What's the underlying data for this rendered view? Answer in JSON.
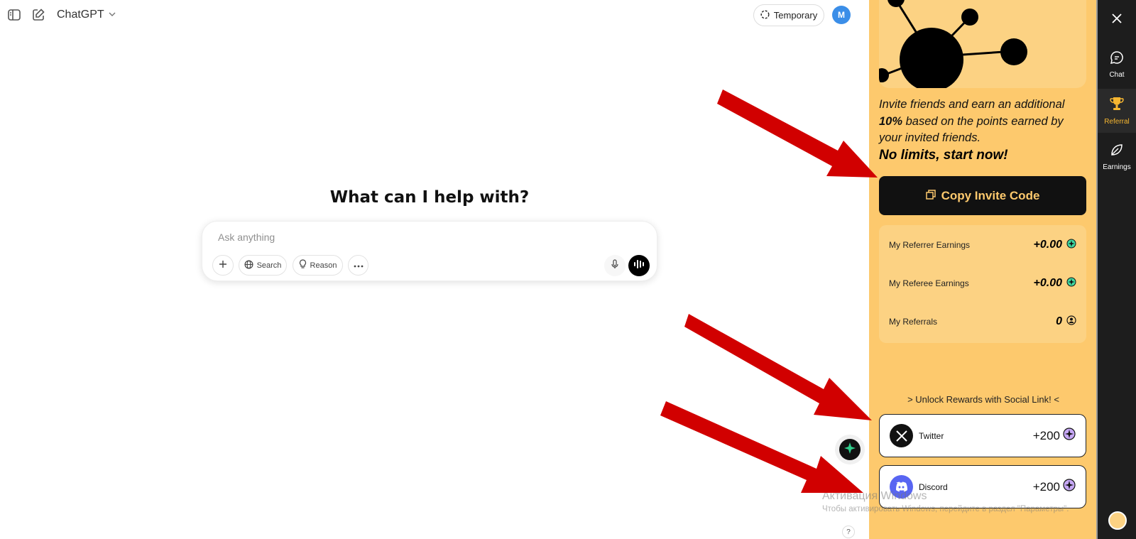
{
  "app": {
    "model_name": "ChatGPT",
    "temporary_label": "Temporary",
    "avatar_initial": "M"
  },
  "main": {
    "headline": "What can I help with?",
    "composer_placeholder": "Ask anything",
    "search_label": "Search",
    "reason_label": "Reason"
  },
  "panel": {
    "invite_line1": "Invite friends and earn an additional",
    "invite_bold": "10%",
    "invite_line2": "based on the points earned by your invited friends.",
    "no_limits": "No limits, start now!",
    "copy_button": "Copy Invite Code",
    "stats": [
      {
        "label": "My Referrer Earnings",
        "value": "+0.00"
      },
      {
        "label": "My Referee Earnings",
        "value": "+0.00"
      },
      {
        "label": "My Referrals",
        "value": "0"
      }
    ],
    "unlock_text": "> Unlock Rewards with Social Link! <",
    "socials": [
      {
        "name": "Twitter",
        "points": "+200"
      },
      {
        "name": "Discord",
        "points": "+200"
      }
    ]
  },
  "rail": {
    "items": [
      {
        "label": "Chat"
      },
      {
        "label": "Referral"
      },
      {
        "label": "Earnings"
      }
    ]
  },
  "overlay": {
    "watermark_title": "Активация Windows",
    "watermark_sub": "Чтобы активировать Windows, перейдите в раздел \"Параметры\".",
    "help": "?"
  },
  "colors": {
    "panel_bg": "#fdc96d",
    "panel_card": "#fcd283",
    "rail_bg": "#1d1d1d",
    "accent_active": "#f7b731",
    "arrow_red": "#d10000"
  }
}
